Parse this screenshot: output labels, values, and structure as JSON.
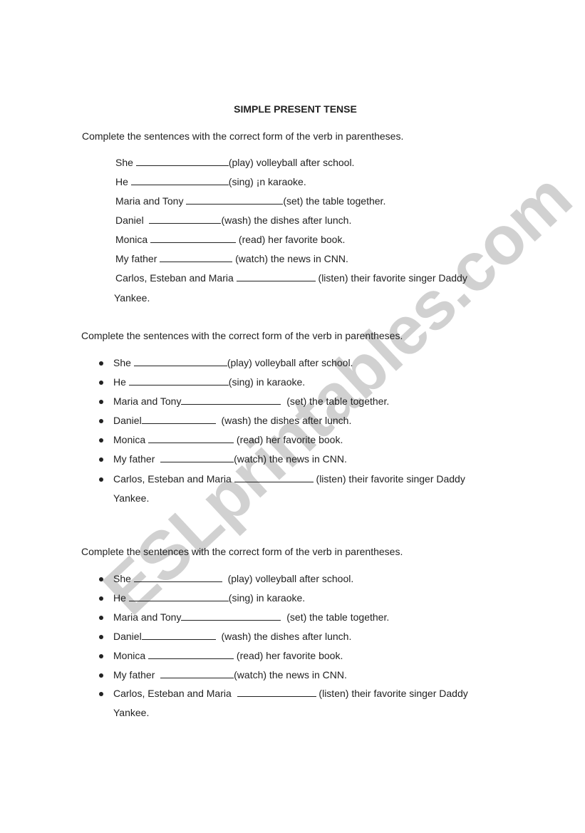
{
  "title": "SIMPLE PRESENT TENSE",
  "watermark": "ESLprintables.com",
  "sections": [
    {
      "instruction": "Complete the sentences with the correct form of the verb in parentheses.",
      "bulleted": false,
      "items": [
        {
          "before": "She ",
          "after": "(play) volleyball after school."
        },
        {
          "before": "He ",
          "after": "(sing) ¡n karaoke."
        },
        {
          "before": "Maria and Tony ",
          "after": "(set) the table together."
        },
        {
          "before": "Daniel  ",
          "after": "(wash) the dishes after lunch."
        },
        {
          "before": "Monica ",
          "after": " (read) her favorite book."
        },
        {
          "before": "My father ",
          "after": " (watch) the news in CNN."
        },
        {
          "before": "Carlos, Esteban and Maria ",
          "after": " (listen) their favorite singer Daddy",
          "continuation": "Yankee."
        }
      ]
    },
    {
      "instruction": "Complete the sentences with the correct form of the verb in parentheses.",
      "bulleted": true,
      "items": [
        {
          "before": "She ",
          "after": "(play) volleyball after school."
        },
        {
          "before": "He ",
          "after": "(sing) in karaoke."
        },
        {
          "before": "Maria and Tony",
          "after": "  (set) the table together."
        },
        {
          "before": "Daniel",
          "after": "  (wash) the dishes after lunch."
        },
        {
          "before": "Monica ",
          "after": " (read) her favorite book."
        },
        {
          "before": "My father  ",
          "after": "(watch) the news in CNN."
        },
        {
          "before": "Carlos, Esteban and Maria ",
          "after": " (listen) their favorite singer Daddy",
          "continuation": "Yankee."
        }
      ]
    },
    {
      "instruction": "Complete the sentences with the correct form of the verb in parentheses.",
      "bulleted": true,
      "items": [
        {
          "before": "She ",
          "after": "  (play) volleyball after school."
        },
        {
          "before": "He ",
          "after": "(sing) in karaoke."
        },
        {
          "before": "Maria and Tony",
          "after": "  (set) the table together."
        },
        {
          "before": "Daniel",
          "after": "  (wash) the dishes after lunch."
        },
        {
          "before": "Monica ",
          "after": " (read) her favorite book."
        },
        {
          "before": "My father  ",
          "after": "(watch) the news in CNN."
        },
        {
          "before": "Carlos, Esteban and Maria  ",
          "after": " (listen) their favorite singer Daddy",
          "continuation": "Yankee."
        }
      ]
    }
  ]
}
